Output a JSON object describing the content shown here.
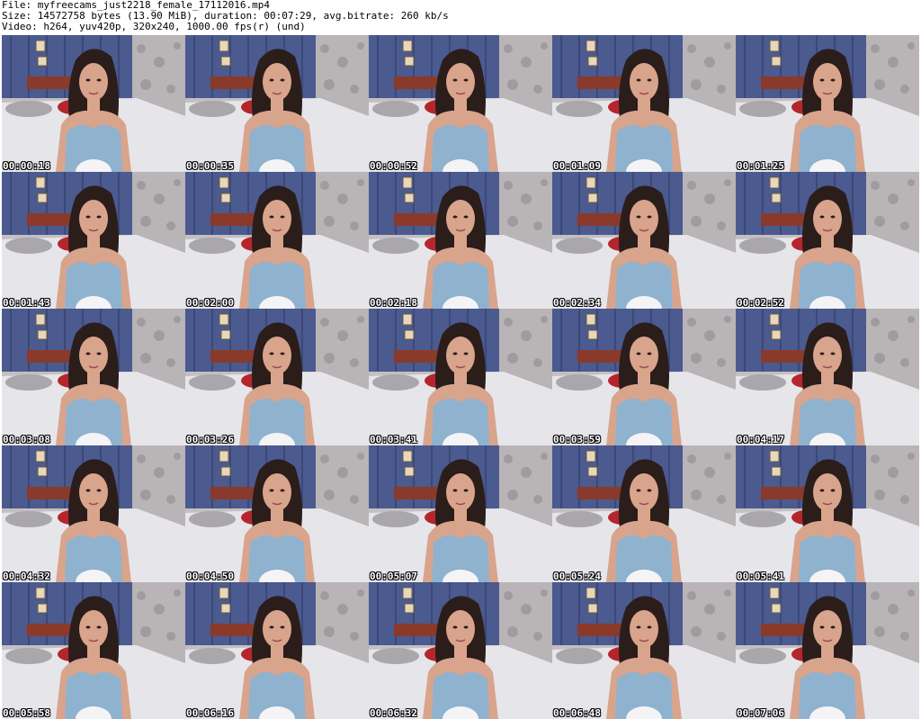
{
  "header": {
    "file_line": "File: myfreecams_just2218_female_17112016.mp4",
    "size_line": "Size: 14572758 bytes (13.90 MiB), duration: 00:07:29, avg.bitrate: 260 kb/s",
    "video_line": "Video: h264, yuv420p, 320x240, 1000.00 fps(r) (und)"
  },
  "thumbnails": [
    {
      "timestamp": "00:00:18"
    },
    {
      "timestamp": "00:00:35"
    },
    {
      "timestamp": "00:00:52"
    },
    {
      "timestamp": "00:01:09"
    },
    {
      "timestamp": "00:01:25"
    },
    {
      "timestamp": "00:01:43"
    },
    {
      "timestamp": "00:02:00"
    },
    {
      "timestamp": "00:02:18"
    },
    {
      "timestamp": "00:02:34"
    },
    {
      "timestamp": "00:02:52"
    },
    {
      "timestamp": "00:03:08"
    },
    {
      "timestamp": "00:03:26"
    },
    {
      "timestamp": "00:03:41"
    },
    {
      "timestamp": "00:03:59"
    },
    {
      "timestamp": "00:04:17"
    },
    {
      "timestamp": "00:04:32"
    },
    {
      "timestamp": "00:04:50"
    },
    {
      "timestamp": "00:05:07"
    },
    {
      "timestamp": "00:05:24"
    },
    {
      "timestamp": "00:05:41"
    },
    {
      "timestamp": "00:05:58"
    },
    {
      "timestamp": "00:06:16"
    },
    {
      "timestamp": "00:06:32"
    },
    {
      "timestamp": "00:06:48"
    },
    {
      "timestamp": "00:07:06"
    }
  ],
  "colors": {
    "curtain": "#4b5a8f",
    "wall_pattern": "#b9b4b6",
    "headboard": "#8a3a2a",
    "bedsheet": "#e6e6ea",
    "pillow_red": "#b5262c",
    "top_denim": "#8fb2cf",
    "hair": "#2b1d1a",
    "skin": "#d9a48c",
    "lamp": "#f4f4f6"
  }
}
